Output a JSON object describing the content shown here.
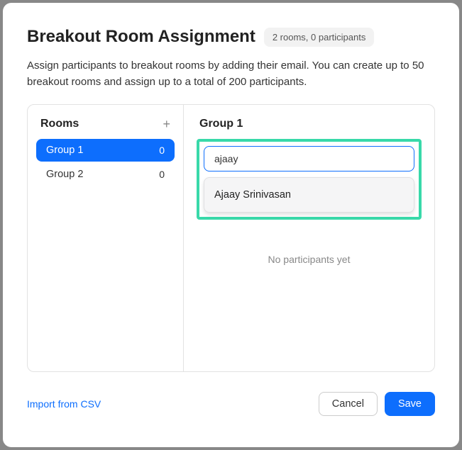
{
  "header": {
    "title": "Breakout Room Assignment",
    "summary": "2 rooms, 0 participants"
  },
  "description": "Assign participants to breakout rooms by adding their email. You can create up to 50 breakout rooms and assign up to a total of 200 participants.",
  "rooms_panel": {
    "heading": "Rooms",
    "items": [
      {
        "name": "Group 1",
        "count": "0",
        "selected": true
      },
      {
        "name": "Group 2",
        "count": "0",
        "selected": false
      }
    ]
  },
  "detail_panel": {
    "heading": "Group 1",
    "search_value": "ajaay",
    "suggestions": [
      "Ajaay Srinivasan"
    ],
    "empty_text": "No participants yet"
  },
  "footer": {
    "import_label": "Import from CSV",
    "cancel_label": "Cancel",
    "save_label": "Save"
  }
}
